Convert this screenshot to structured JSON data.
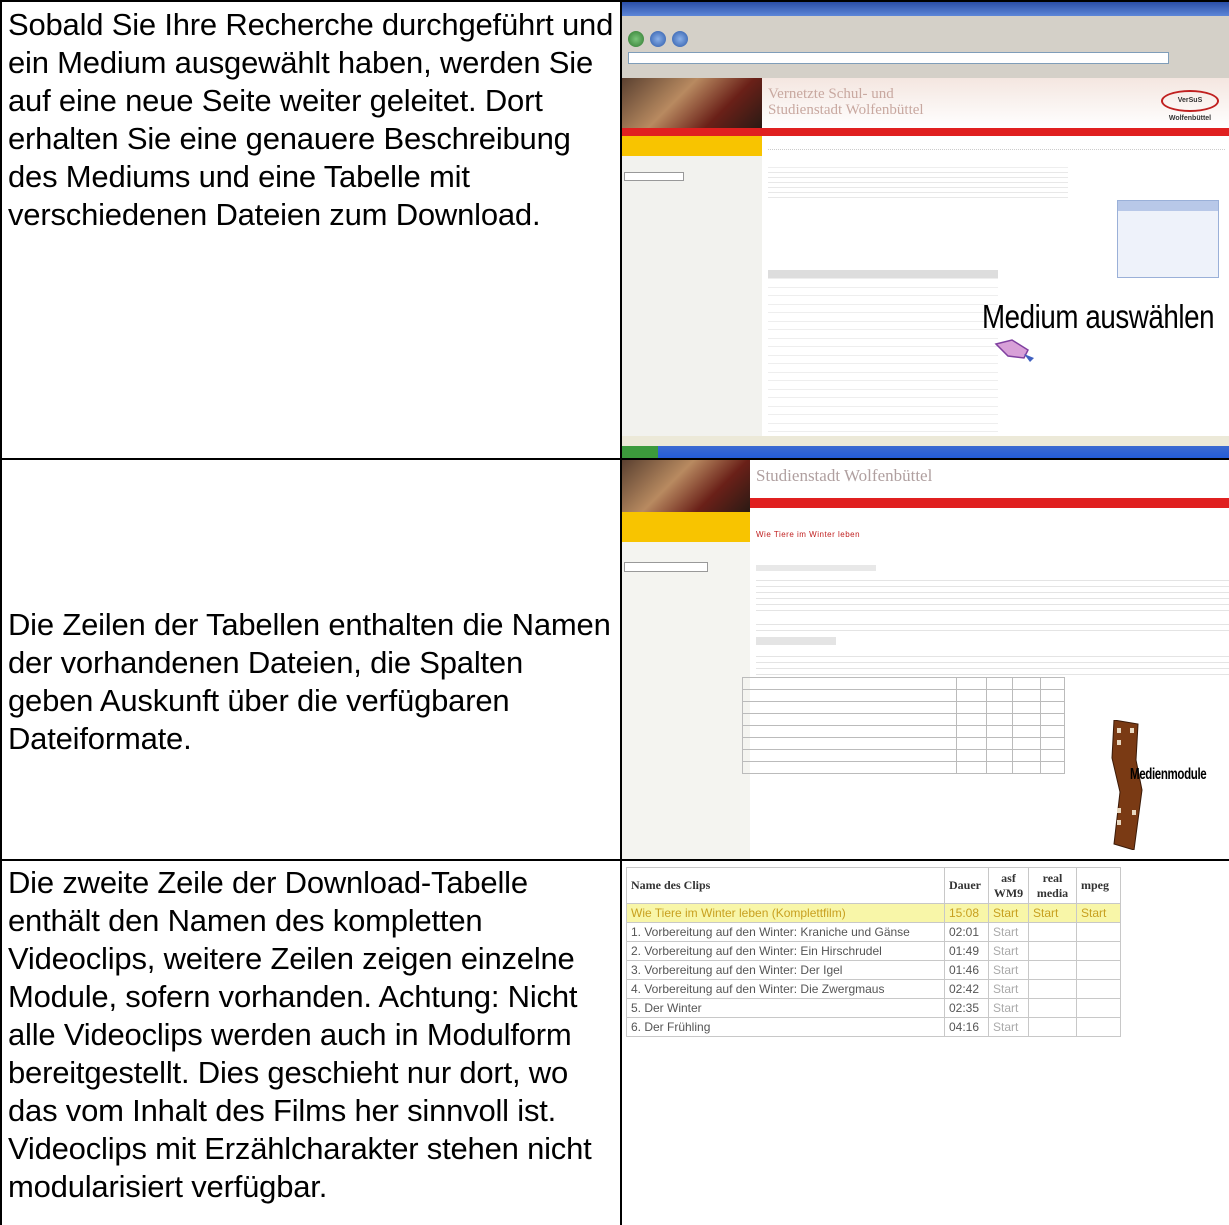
{
  "rows": [
    {
      "text": "Sobald Sie Ihre Recherche durchgeführt und ein Medium ausgewählt haben, werden Sie auf eine neue Seite weiter geleitet. Dort erhalten Sie eine genauere Beschreibung des Mediums und eine Tabelle mit verschiedenen Dateien zum Download."
    },
    {
      "text": "Die Zeilen der Tabellen enthalten die Namen der vorhandenen Dateien, die Spalten geben Auskunft über die verfügbaren Dateiformate."
    },
    {
      "text": "Die zweite Zeile der Download-Tabelle enthält den Namen des kompletten Videoclips, weitere Zeilen zeigen einzelne Module, sofern vorhanden. Achtung: Nicht alle Videoclips werden auch in Modulform bereitgestellt. Dies geschieht nur dort, wo das vom Inhalt des Films her sinnvoll ist. Videoclips mit Erzählcharakter stehen nicht modularisiert verfügbar."
    }
  ],
  "screenshot1": {
    "site_title_line1": "Vernetzte Schul- und",
    "site_title_line2": "Studienstadt Wolfenbüttel",
    "logo": "VerSuS Wolfenbüttel",
    "callout": "Medium auswählen"
  },
  "screenshot2": {
    "site_title": "Studienstadt Wolfenbüttel",
    "page_title": "Wie Tiere im Winter leben",
    "callout": "Medienmodule"
  },
  "clip_table": {
    "headers": [
      "Name des Clips",
      "Dauer",
      "asf WM9",
      "real media",
      "mpeg"
    ],
    "rows": [
      {
        "name": "Wie Tiere im Winter leben (Komplettfilm)",
        "dauer": "15:08",
        "asf": "Start",
        "real": "Start",
        "mpeg": "Start"
      },
      {
        "name": "1. Vorbereitung auf den Winter: Kraniche und Gänse",
        "dauer": "02:01",
        "asf": "Start",
        "real": "",
        "mpeg": ""
      },
      {
        "name": "2. Vorbereitung auf den Winter: Ein Hirschrudel",
        "dauer": "01:49",
        "asf": "Start",
        "real": "",
        "mpeg": ""
      },
      {
        "name": "3. Vorbereitung auf den Winter: Der Igel",
        "dauer": "01:46",
        "asf": "Start",
        "real": "",
        "mpeg": ""
      },
      {
        "name": "4. Vorbereitung auf den Winter: Die Zwergmaus",
        "dauer": "02:42",
        "asf": "Start",
        "real": "",
        "mpeg": ""
      },
      {
        "name": "5. Der Winter",
        "dauer": "02:35",
        "asf": "Start",
        "real": "",
        "mpeg": ""
      },
      {
        "name": "6. Der Frühling",
        "dauer": "04:16",
        "asf": "Start",
        "real": "",
        "mpeg": ""
      }
    ]
  }
}
